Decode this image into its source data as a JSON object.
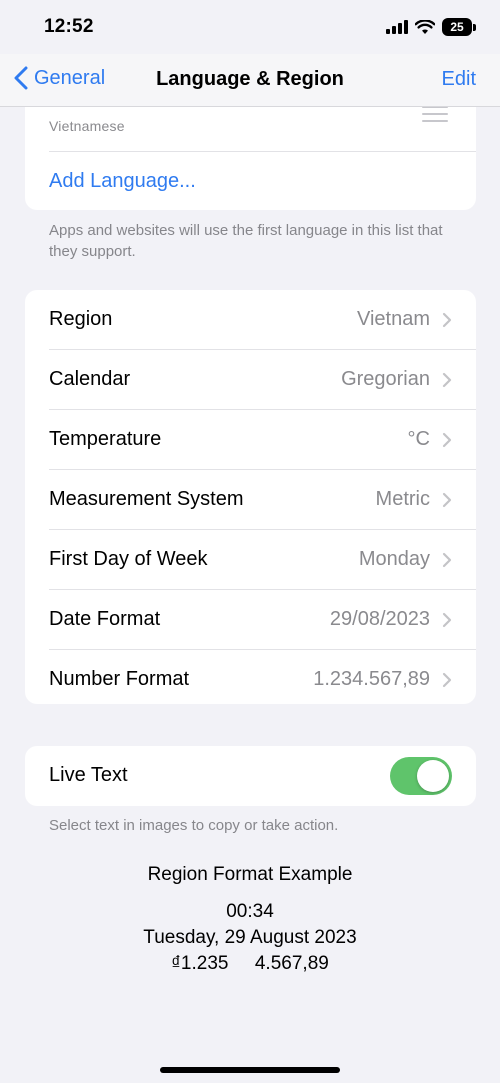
{
  "status_bar": {
    "time": "12:52",
    "battery": "25"
  },
  "nav": {
    "back_label": "General",
    "title": "Language & Region",
    "edit_label": "Edit"
  },
  "languages": {
    "items": [
      {
        "subtitle": "Vietnamese"
      }
    ],
    "add_label": "Add Language..."
  },
  "language_footnote": "Apps and websites will use the first language in this list that they support.",
  "settings": [
    {
      "label": "Region",
      "value": "Vietnam"
    },
    {
      "label": "Calendar",
      "value": "Gregorian"
    },
    {
      "label": "Temperature",
      "value": "°C"
    },
    {
      "label": "Measurement System",
      "value": "Metric"
    },
    {
      "label": "First Day of Week",
      "value": "Monday"
    },
    {
      "label": "Date Format",
      "value": "29/08/2023"
    },
    {
      "label": "Number Format",
      "value": "1.234.567,89"
    }
  ],
  "live_text": {
    "label": "Live Text",
    "enabled": true,
    "footnote": "Select text in images to copy or take action."
  },
  "region_example": {
    "title": "Region Format Example",
    "time": "00:34",
    "date": "Tuesday, 29 August 2023",
    "numbers": "₫1.235     4.567,89"
  },
  "colors": {
    "accent": "#2f7bf0",
    "toggle_on": "#5fc46b",
    "background": "#f2f2f7"
  }
}
